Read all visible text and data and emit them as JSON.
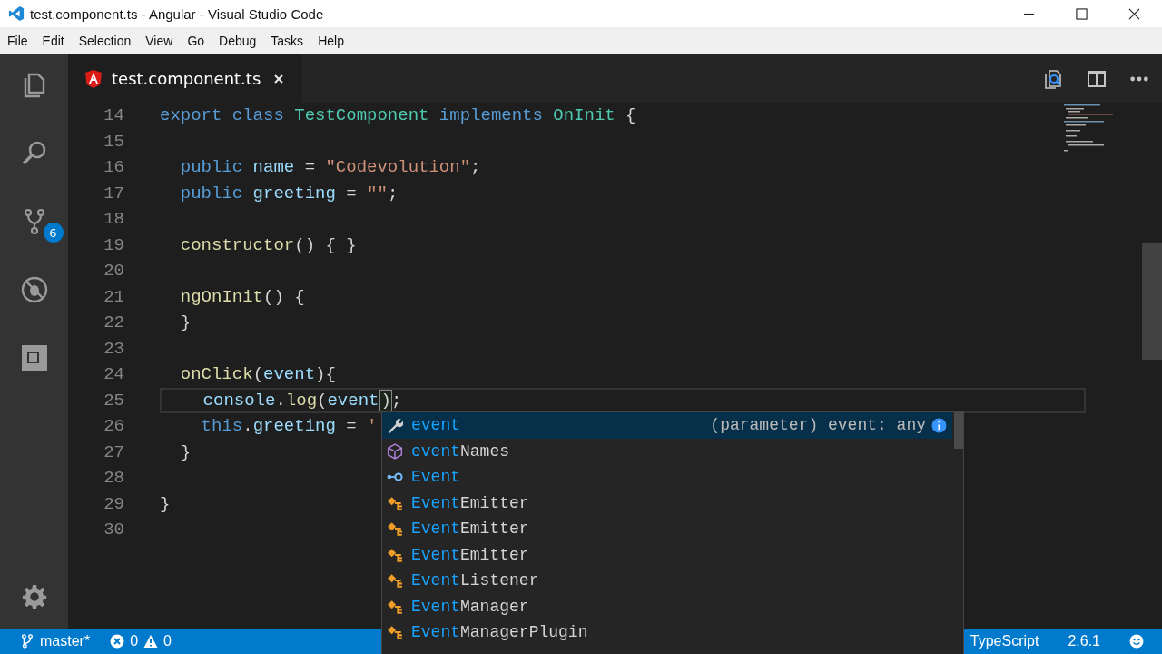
{
  "window": {
    "title": "test.component.ts - Angular - Visual Studio Code"
  },
  "menu": [
    "File",
    "Edit",
    "Selection",
    "View",
    "Go",
    "Debug",
    "Tasks",
    "Help"
  ],
  "activity_bar": {
    "source_control_badge": "6"
  },
  "tabs": [
    {
      "label": "test.component.ts",
      "selected": true
    }
  ],
  "editor": {
    "lines": [
      {
        "number": "14",
        "current": false,
        "tokens": [
          {
            "kind": "keyword",
            "text": "export class"
          },
          {
            "kind": "type",
            "text": " TestComponent"
          },
          {
            "kind": "keyword",
            "text": " implements"
          },
          {
            "kind": "type",
            "text": " OnInit"
          },
          {
            "kind": "plain",
            "text": " {"
          }
        ]
      },
      {
        "number": "15",
        "current": false
      },
      {
        "number": "16",
        "current": false,
        "tokens": [
          {
            "kind": "keyword",
            "text": "  public"
          },
          {
            "kind": "prop",
            "text": " name"
          },
          {
            "kind": "plain",
            "text": " = "
          },
          {
            "kind": "string",
            "text": "\"Codevolution\""
          },
          {
            "kind": "plain",
            "text": ";"
          }
        ]
      },
      {
        "number": "17",
        "current": false,
        "tokens": [
          {
            "kind": "keyword",
            "text": "  public"
          },
          {
            "kind": "prop",
            "text": " greeting"
          },
          {
            "kind": "plain",
            "text": " = "
          },
          {
            "kind": "string",
            "text": "\"\""
          },
          {
            "kind": "plain",
            "text": ";"
          }
        ]
      },
      {
        "number": "18",
        "current": false
      },
      {
        "number": "19",
        "current": false,
        "tokens": [
          {
            "kind": "func",
            "text": "  constructor"
          },
          {
            "kind": "plain",
            "text": "() { }"
          }
        ]
      },
      {
        "number": "20",
        "current": false
      },
      {
        "number": "21",
        "current": false,
        "tokens": [
          {
            "kind": "func",
            "text": "  ngOnInit"
          },
          {
            "kind": "plain",
            "text": "() {"
          }
        ]
      },
      {
        "number": "22",
        "current": false,
        "tokens": [
          {
            "kind": "plain",
            "text": "  }"
          }
        ]
      },
      {
        "number": "23",
        "current": false
      },
      {
        "number": "24",
        "current": false,
        "tokens": [
          {
            "kind": "func",
            "text": "  onClick"
          },
          {
            "kind": "plain",
            "text": "("
          },
          {
            "kind": "prop",
            "text": "event"
          },
          {
            "kind": "plain",
            "text": "){"
          }
        ]
      },
      {
        "number": "25",
        "current": true,
        "tokens": [
          {
            "kind": "prop",
            "text": "    console"
          },
          {
            "kind": "plain",
            "text": "."
          },
          {
            "kind": "func",
            "text": "log"
          },
          {
            "kind": "plain",
            "text": "("
          },
          {
            "kind": "prop",
            "text": "event"
          },
          {
            "kind": "bracket",
            "text": ")"
          },
          {
            "kind": "plain",
            "text": ";"
          }
        ]
      },
      {
        "number": "26",
        "current": false,
        "tokens": [
          {
            "kind": "keyword",
            "text": "    this"
          },
          {
            "kind": "plain",
            "text": "."
          },
          {
            "kind": "prop",
            "text": "greeting"
          },
          {
            "kind": "plain",
            "text": " = "
          },
          {
            "kind": "string",
            "text": "'"
          }
        ]
      },
      {
        "number": "27",
        "current": false,
        "tokens": [
          {
            "kind": "plain",
            "text": "  }"
          }
        ]
      },
      {
        "number": "28",
        "current": false
      },
      {
        "number": "29",
        "current": false,
        "tokens": [
          {
            "kind": "plain",
            "text": "}"
          }
        ]
      },
      {
        "number": "30",
        "current": false
      }
    ]
  },
  "suggestions": [
    {
      "kind": "variable",
      "match": "event",
      "detail": "(parameter) event: any",
      "selected": true
    },
    {
      "kind": "property",
      "match": "event",
      "rest": "Names",
      "selected": false
    },
    {
      "kind": "interface",
      "match": "Event",
      "selected": false
    },
    {
      "kind": "class",
      "match": "Event",
      "rest": "Emitter",
      "selected": false
    },
    {
      "kind": "class",
      "match": "Event",
      "rest": "Emitter",
      "selected": false
    },
    {
      "kind": "class",
      "match": "Event",
      "rest": "Emitter",
      "selected": false
    },
    {
      "kind": "class",
      "match": "Event",
      "rest": "Listener",
      "selected": false
    },
    {
      "kind": "class",
      "match": "Event",
      "rest": "Manager",
      "selected": false
    },
    {
      "kind": "class",
      "match": "Event",
      "rest": "ManagerPlugin",
      "selected": false
    }
  ],
  "status_bar": {
    "branch": "master*",
    "errors": "0",
    "warnings": "0",
    "language": "TypeScript",
    "version": "2.6.1"
  }
}
